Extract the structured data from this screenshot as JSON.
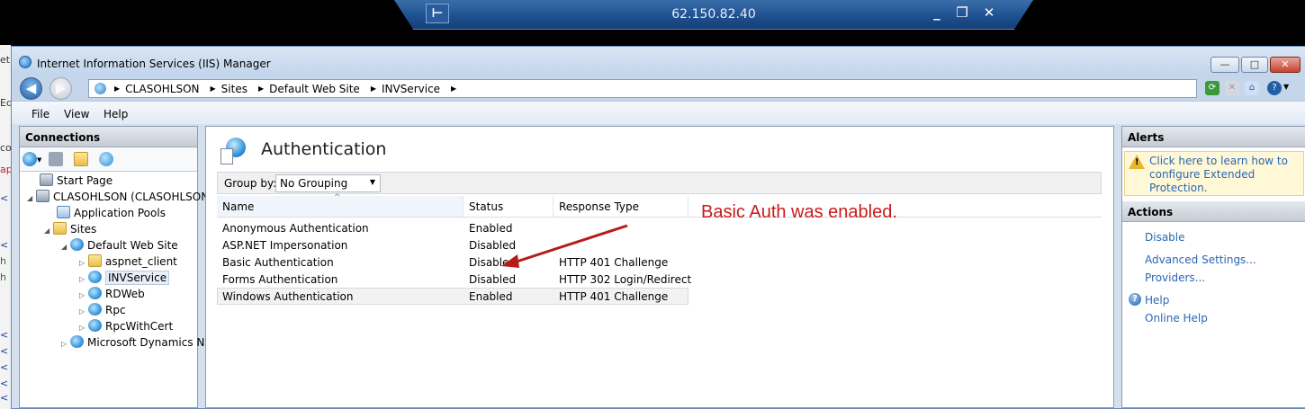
{
  "remote": {
    "ip": "62.150.82.40",
    "pin": "⊢",
    "min": "_",
    "restore": "❐",
    "close": "✕"
  },
  "background_strip": {
    "fragments": [
      "et",
      "Ed",
      "co",
      "ap",
      "<",
      "<",
      "h",
      "h",
      "<",
      "<",
      "<",
      "<",
      "<",
      "<"
    ]
  },
  "window": {
    "title": "Internet Information Services (IIS) Manager",
    "min": "—",
    "max": "□",
    "close": "✕"
  },
  "address": {
    "crumbs": [
      "CLASOHLSON",
      "Sites",
      "Default Web Site",
      "INVService"
    ]
  },
  "menu": [
    "File",
    "View",
    "Help"
  ],
  "connections": {
    "header": "Connections",
    "tree": [
      {
        "label": "Start Page",
        "icon": "start-page-icon"
      },
      {
        "label": "CLASOHLSON (CLASOHLSON",
        "icon": "server-icon"
      },
      {
        "label": "Application Pools",
        "icon": "app-pools-icon"
      },
      {
        "label": "Sites",
        "icon": "sites-folder-icon"
      },
      {
        "label": "Default Web Site",
        "icon": "globe-icon"
      },
      {
        "label": "aspnet_client",
        "icon": "folder-icon"
      },
      {
        "label": "INVService",
        "icon": "web-app-icon"
      },
      {
        "label": "RDWeb",
        "icon": "web-app-icon"
      },
      {
        "label": "Rpc",
        "icon": "web-app-icon"
      },
      {
        "label": "RpcWithCert",
        "icon": "web-app-icon"
      },
      {
        "label": "Microsoft Dynamics N",
        "icon": "globe-icon"
      }
    ]
  },
  "feature": {
    "title": "Authentication",
    "group_by_label": "Group by:",
    "group_by_value": "No Grouping",
    "columns": [
      "Name",
      "Status",
      "Response Type"
    ],
    "rows": [
      {
        "name": "Anonymous Authentication",
        "status": "Enabled",
        "response": ""
      },
      {
        "name": "ASP.NET Impersonation",
        "status": "Disabled",
        "response": ""
      },
      {
        "name": "Basic Authentication",
        "status": "Disabled",
        "response": "HTTP 401 Challenge"
      },
      {
        "name": "Forms Authentication",
        "status": "Disabled",
        "response": "HTTP 302 Login/Redirect"
      },
      {
        "name": "Windows Authentication",
        "status": "Enabled",
        "response": "HTTP 401 Challenge"
      }
    ],
    "annotation": "Basic Auth was enabled.",
    "annotation_color": "#c81a1a"
  },
  "alerts": {
    "header": "Alerts",
    "message": "Click here to learn how to configure Extended Protection."
  },
  "actions": {
    "header": "Actions",
    "items": [
      "Disable",
      "Advanced Settings...",
      "Providers...",
      "Help",
      "Online Help"
    ]
  },
  "colors": {
    "link": "#2a66b5",
    "accent": "#1f5fa8"
  }
}
